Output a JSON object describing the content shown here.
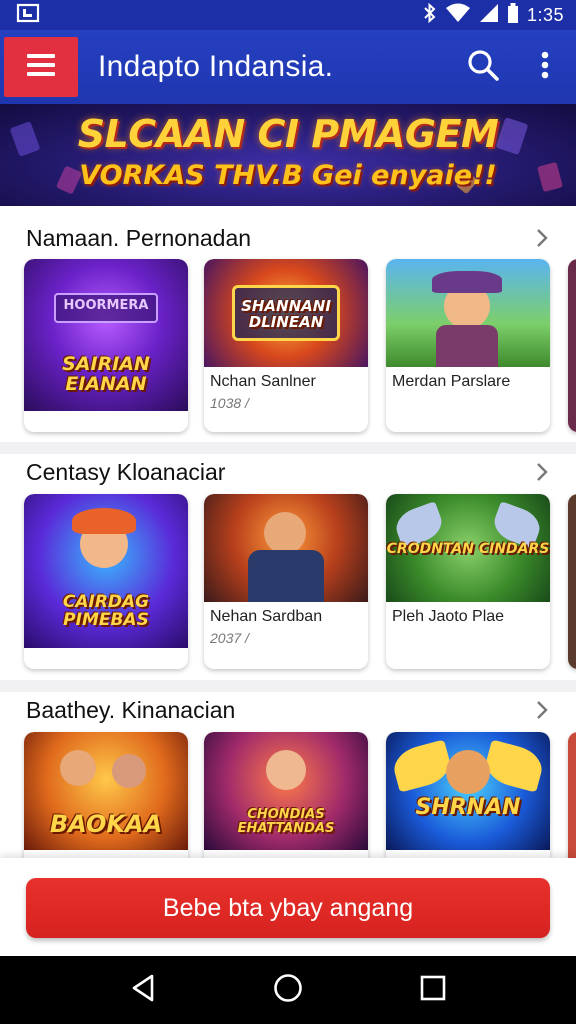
{
  "status_bar": {
    "time": "1:35",
    "icons": [
      "notification-icon",
      "bluetooth-icon",
      "wifi-icon",
      "signal-icon",
      "battery-icon"
    ]
  },
  "app_bar": {
    "title": "Indapto Indansia.",
    "menu_icon": "hamburger-menu-icon",
    "search_icon": "search-icon",
    "more_icon": "more-vertical-icon",
    "menu_color": "#e23040",
    "bar_color": "#1f36b0"
  },
  "banner": {
    "line1": "SLCAAN CI PMAGEM",
    "line2": "VORKAS THV.B Gei enyaie!!"
  },
  "sections": [
    {
      "title": "Namaan. Pernonadan",
      "cards": [
        {
          "art_text": "SAIRIAN EIANAN",
          "art_sign": "HOORMERA",
          "name": "",
          "meta": ""
        },
        {
          "art_text": "SHANNANI DLINEAN",
          "name": "Nchan Sanlner",
          "meta": "1038 /"
        },
        {
          "art_text": "",
          "name": "Merdan Parslare",
          "meta": ""
        }
      ]
    },
    {
      "title": "Centasy Kloanaciar",
      "cards": [
        {
          "art_text": "CAIRDAG PIMEBAS",
          "name": "",
          "meta": ""
        },
        {
          "art_text": "",
          "name": "Nehan Sardban",
          "meta": "2037 /"
        },
        {
          "art_text": "CRODNTAN CINDARS",
          "name": "Pleh Jaoto Plae",
          "meta": ""
        }
      ]
    },
    {
      "title": "Baathey. Kinanacian",
      "cards": [
        {
          "art_text": "BAOKAA",
          "name": "",
          "meta": ""
        },
        {
          "art_text": "CHONDIAS EHATTANDAS",
          "name": "",
          "meta": ""
        },
        {
          "art_text": "SHRNAN",
          "name": "",
          "meta": ""
        }
      ]
    }
  ],
  "cta": {
    "label": "Bebe bta ybay angang",
    "color": "#e02a26"
  },
  "nav_bar": {
    "icons": [
      "back-icon",
      "home-icon",
      "recents-icon"
    ]
  }
}
